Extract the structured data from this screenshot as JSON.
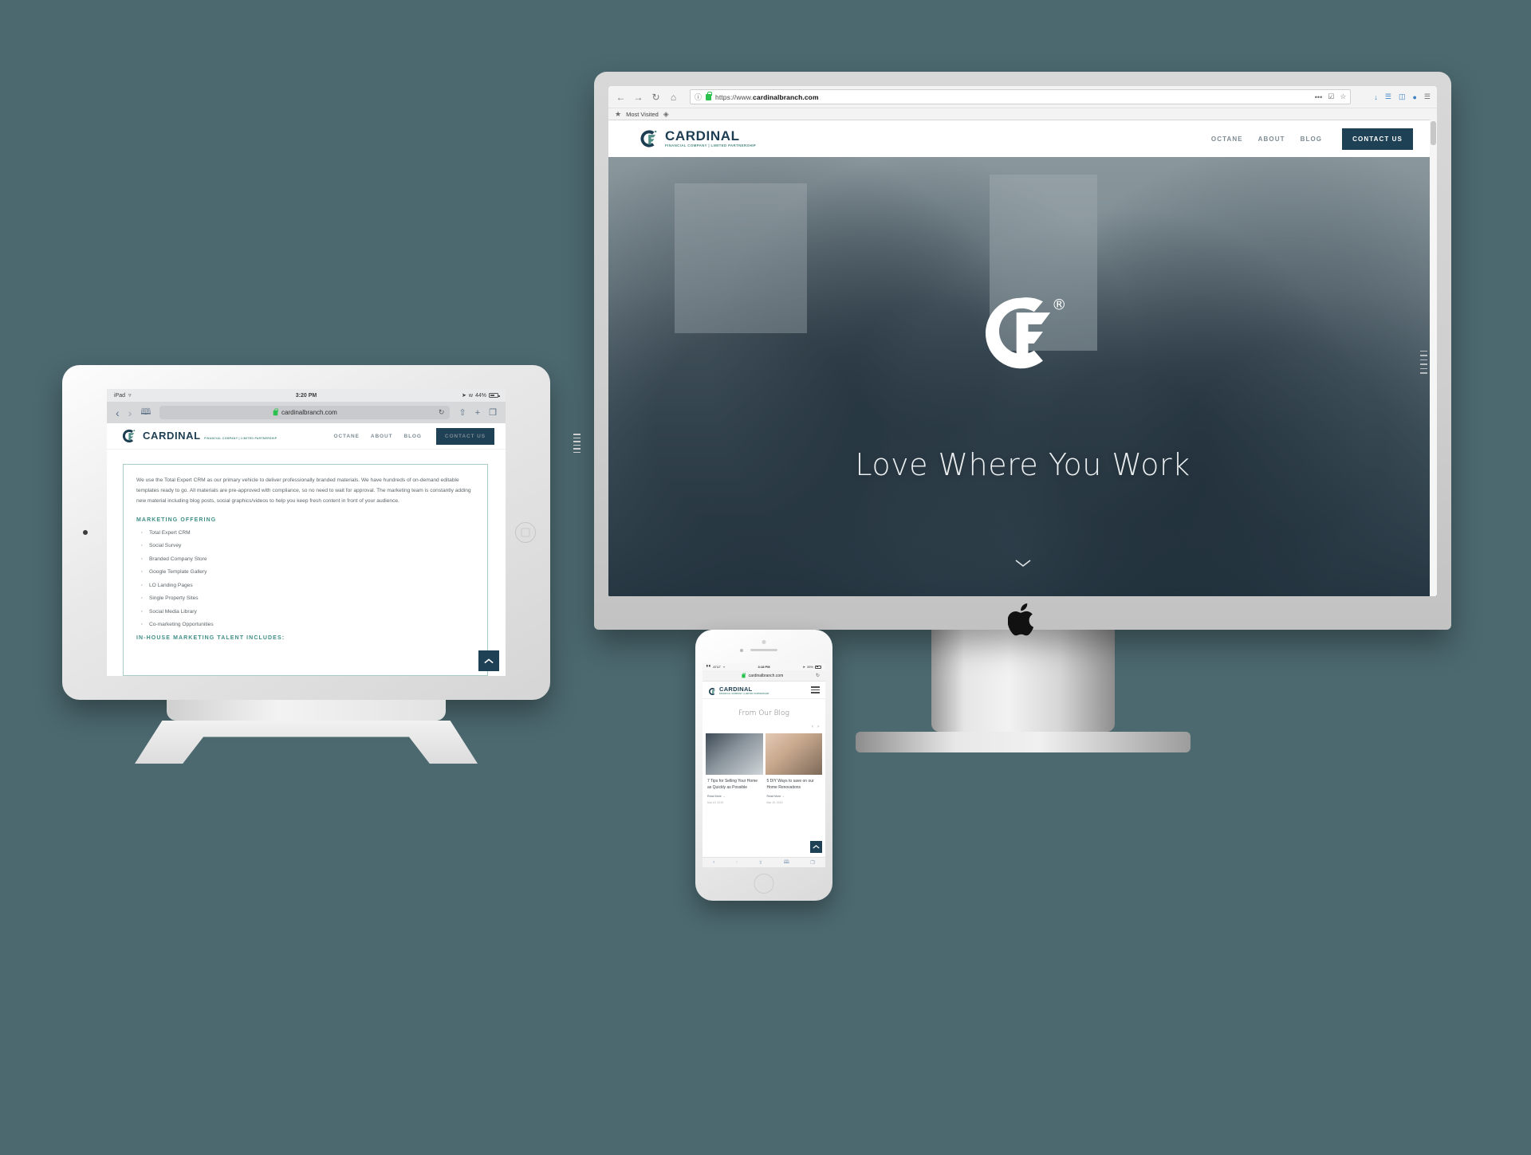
{
  "background_color": "#4c6970",
  "brand": {
    "name": "CARDINAL",
    "tagline_sub": "FINANCIAL COMPANY | LIMITED PARTNERSHIP",
    "accent_navy": "#1e4155",
    "accent_teal": "#3f8e86",
    "mark": "cf-monogram"
  },
  "desktop": {
    "device": "imac",
    "browser": {
      "back": "←",
      "forward": "→",
      "reload": "↻",
      "home": "⌂",
      "url_protocol": "https://www.",
      "url_domain": "cardinalbranch.com",
      "url_full": "https://www.cardinalbranch.com",
      "page_action_menu": "•••",
      "reader_icon": "reader-view-icon",
      "bookmark_star": "☆",
      "bookmarks_label": "Most Visited",
      "download_icon": "↓",
      "library_icon": "library-icon",
      "sidebar_icon": "sidebar-icon",
      "account_icon": "account-icon",
      "menu_icon": "☰"
    },
    "site": {
      "nav": [
        "OCTANE",
        "ABOUT",
        "BLOG"
      ],
      "cta": "CONTACT US",
      "hero_tagline": "Love Where You Work",
      "hero_logo_mark": "CF",
      "hero_registered": "®",
      "scroll_chevron": "chevron-down"
    }
  },
  "tablet": {
    "device": "ipad",
    "status": {
      "carrier": "iPad",
      "wifi": "wifi-icon",
      "time": "3:20 PM",
      "location_icon": "location-arrow-icon",
      "bluetooth_icon": "bluetooth-icon",
      "battery_percent": "44%"
    },
    "browser": {
      "back": "‹",
      "forward": "›",
      "bookmarks_icon": "book-icon",
      "url": "cardinalbranch.com",
      "reload": "↻",
      "share_icon": "share-icon",
      "new_tab_icon": "+",
      "tabs_icon": "tabs-icon"
    },
    "site": {
      "nav": [
        "OCTANE",
        "ABOUT",
        "BLOG"
      ],
      "cta": "CONTACT US",
      "paragraph": "We use the Total Expert CRM as our primary vehicle to deliver professionally branded materials. We have hundreds of on-demand editable templates ready to go. All materials are pre-approved with compliance, so no need to wait for approval. The marketing team is constantly adding new material including blog posts, social graphics/videos to help you keep fresh content in front of your audience.",
      "offering_heading": "MARKETING OFFERING",
      "offering_items": [
        "Total Expert CRM",
        "Social Survey",
        "Branded Company Store",
        "Google Template Gallery",
        "LO Landing Pages",
        "Single Property Sites",
        "Social Media Library",
        "Co-marketing Opportunities"
      ],
      "talent_heading": "IN-HOUSE MARKETING TALENT INCLUDES:",
      "scroll_top": "chevron-up"
    }
  },
  "phone": {
    "device": "iphone",
    "status": {
      "signal": "signal-bars-icon",
      "carrier": "AT&T",
      "wifi": "wifi-icon",
      "time": "3:18 PM",
      "location_icon": "location-arrow-icon",
      "battery_percent": "35%"
    },
    "browser": {
      "url": "cardinalbranch.com",
      "reload": "↻",
      "back": "‹",
      "forward": "›",
      "share_icon": "share-icon",
      "bookmarks_icon": "book-icon",
      "tabs_icon": "tabs-icon"
    },
    "site": {
      "menu_icon": "hamburger-menu-icon",
      "section_title": "From Our Blog",
      "prev_arrow": "‹",
      "next_arrow": "›",
      "posts": [
        {
          "title": "7 Tips for Selling Your Home as Quickly as Possible",
          "read_more": "Read More →",
          "date": "Mar 19, 2019",
          "thumb": "people-walking-photo"
        },
        {
          "title": "5 DIY Ways to save on our Home Renovations",
          "read_more": "Read More →",
          "date": "Mar 19, 2019",
          "thumb": "woman-painting-photo"
        }
      ],
      "scroll_top": "chevron-up"
    }
  }
}
